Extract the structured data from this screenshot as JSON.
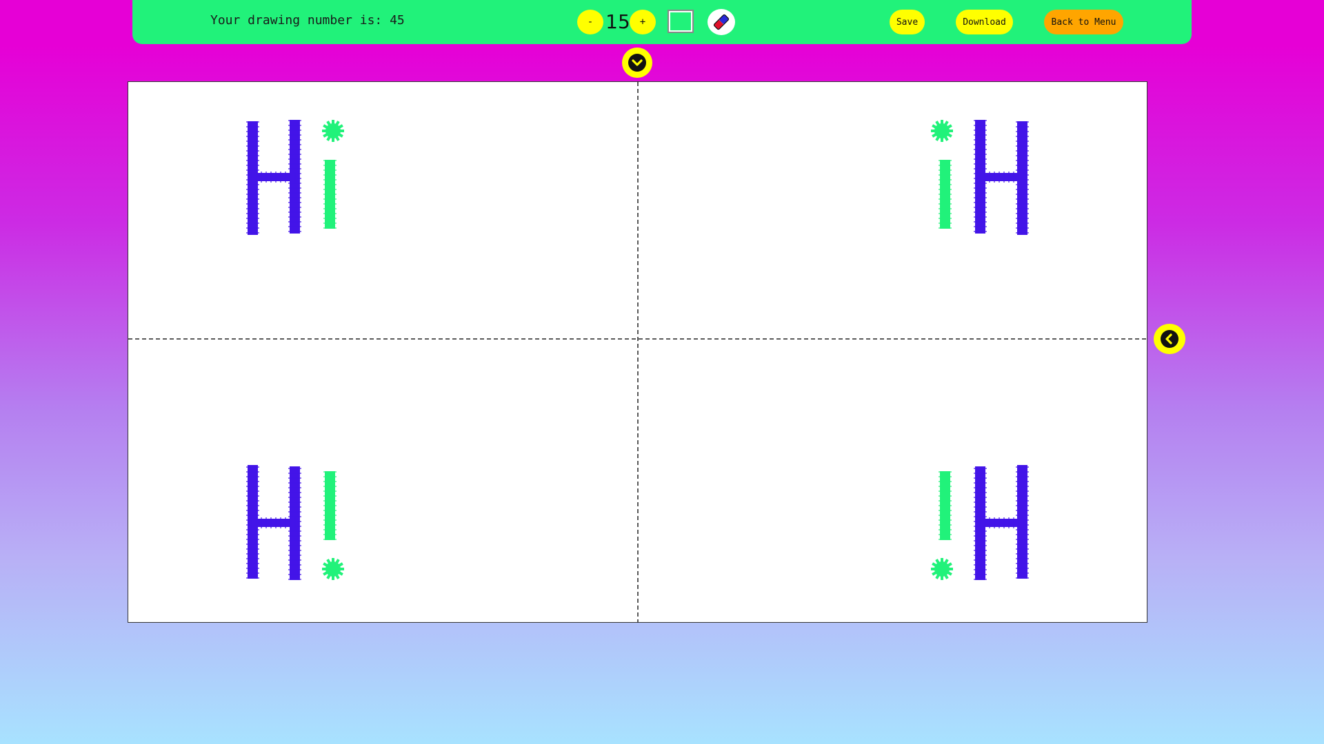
{
  "toolbar": {
    "drawing_number_text": "Your drawing number is: 45",
    "decrease_label": "-",
    "brush_size": "15",
    "increase_label": "+",
    "current_color": "#21f27a",
    "save_label": "Save",
    "download_label": "Download",
    "back_label": "Back to Menu"
  },
  "icons": {
    "eraser": "eraser-icon",
    "collapse_toolbar": "chevron-down-icon",
    "side_panel": "chevron-left-icon"
  },
  "drawing": {
    "letter_color": "#4314e8",
    "accent_color": "#21f27a",
    "symmetry": "four-way mirror"
  },
  "colors": {
    "toolbar_bg": "#21f27a",
    "button_yellow": "#ffff00",
    "button_orange": "#ffa500"
  }
}
